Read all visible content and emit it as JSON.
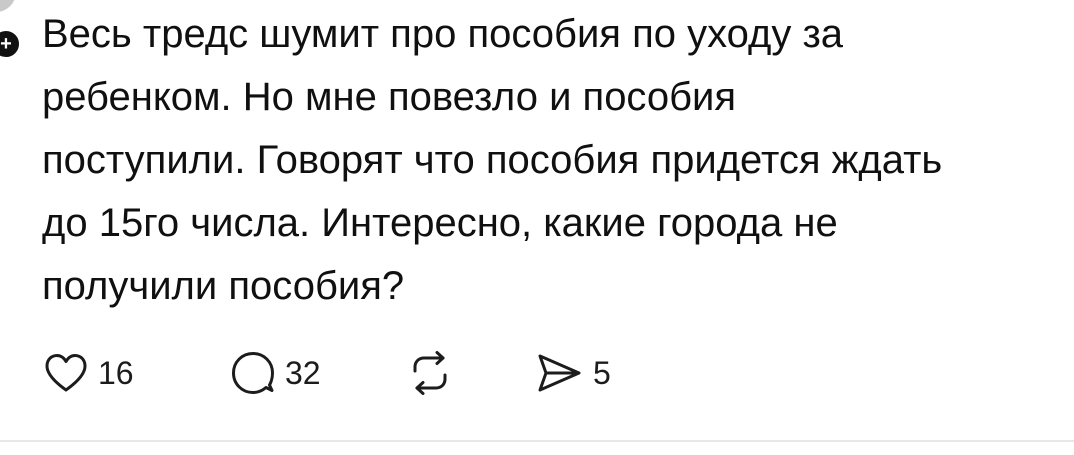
{
  "post": {
    "lines": [
      "Весь тредс шумит про пособия по уходу за",
      "ребенком. Но мне повезло и пособия",
      "поступили. Говорят что пособия придется ждать",
      "до 15го числа. Интересно, какие города не",
      "получили пособия?"
    ],
    "actions": {
      "like": {
        "icon": "heart-icon",
        "count": "16"
      },
      "reply": {
        "icon": "comment-icon",
        "count": "32"
      },
      "repost": {
        "icon": "repost-icon"
      },
      "share": {
        "icon": "send-icon",
        "count": "5"
      }
    }
  },
  "colors": {
    "text": "#101010",
    "icon": "#1c1c1c",
    "divider": "#e7e7e7",
    "background": "#ffffff"
  }
}
